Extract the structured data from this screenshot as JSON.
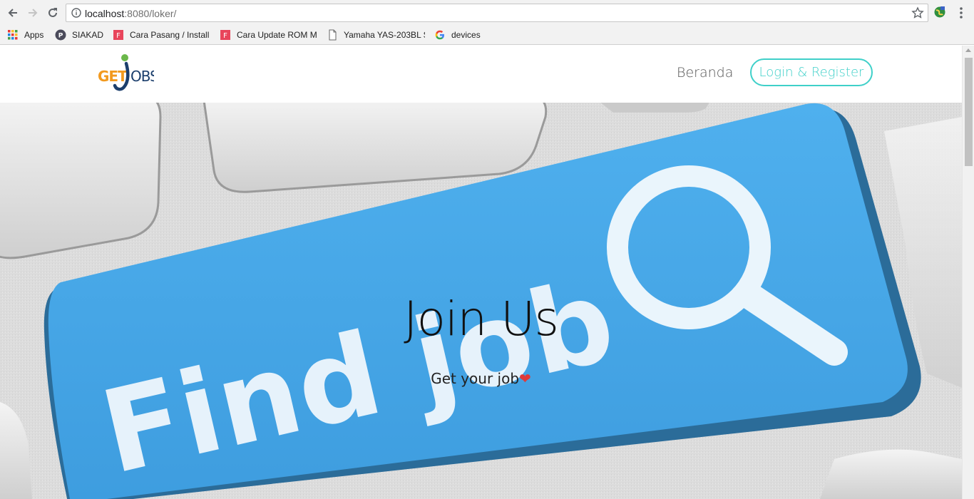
{
  "browser": {
    "url_host": "localhost",
    "url_path": ":8080/loker/",
    "bookmarks": [
      {
        "label": "Apps",
        "icon": "apps-grid-icon"
      },
      {
        "label": "SIAKAD",
        "icon": "p-circle-icon"
      },
      {
        "label": "Cara Pasang / Install",
        "icon": "f-square-icon"
      },
      {
        "label": "Cara Update ROM M",
        "icon": "f-square-icon"
      },
      {
        "label": "Yamaha YAS-203BL S",
        "icon": "page-icon"
      },
      {
        "label": "devices",
        "icon": "google-g-icon"
      }
    ]
  },
  "header": {
    "logo_text": "GETJOBS",
    "nav": {
      "home": "Beranda",
      "login": "Login & Register"
    }
  },
  "hero": {
    "title": "Join Us",
    "subtitle": "Get your job",
    "heart": "❤",
    "key_text": "Find job"
  },
  "colors": {
    "accent": "#3fd0c9",
    "key_blue": "#46a6e6",
    "heart": "#e03a3a"
  }
}
